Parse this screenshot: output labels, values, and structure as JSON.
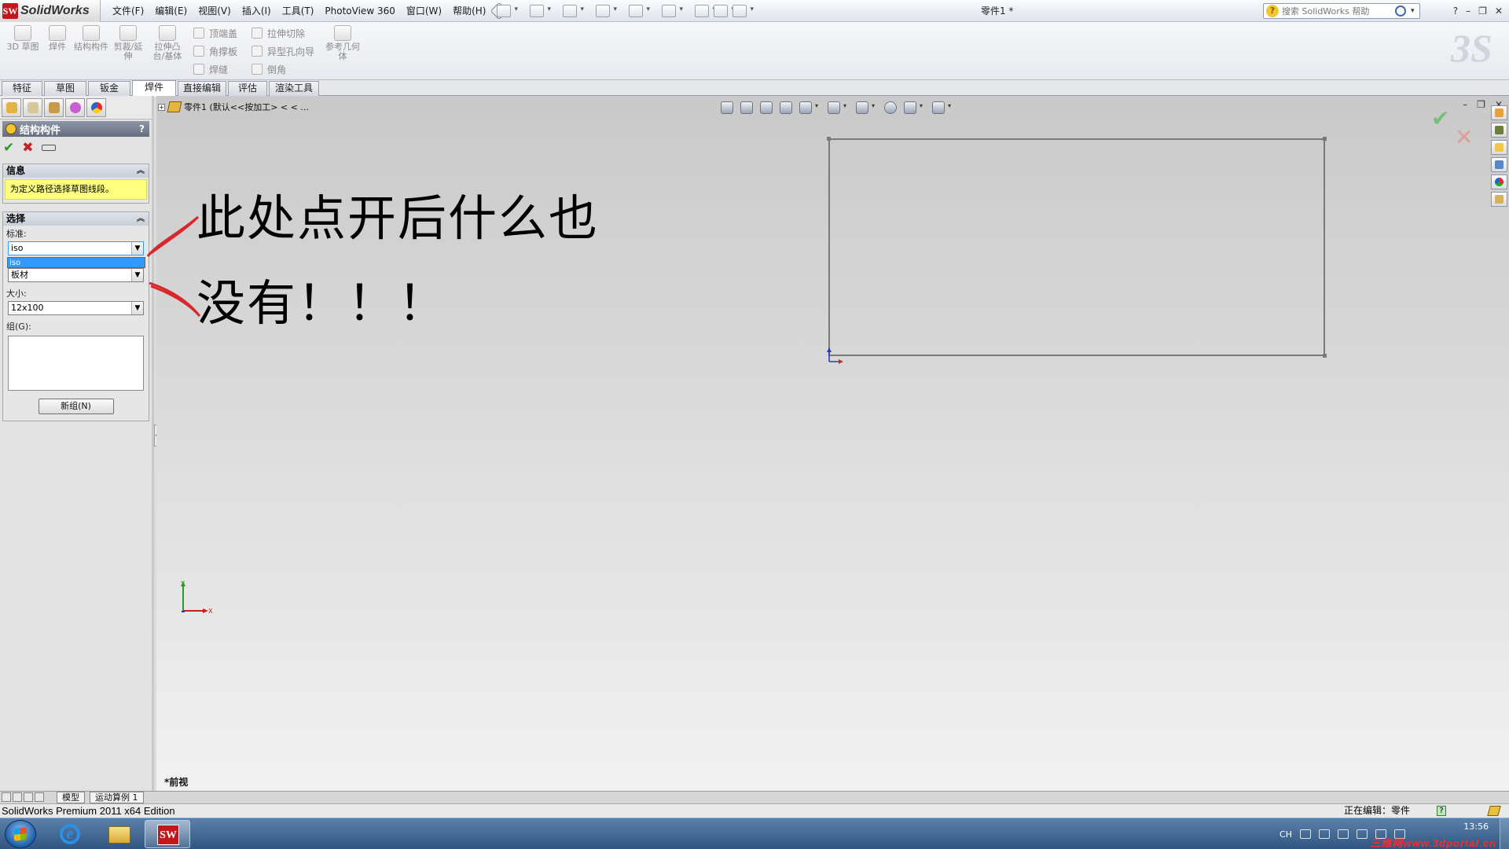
{
  "app": {
    "logo_text": "SolidWorks",
    "logo_mark": "SW",
    "doc_title": "零件1 *",
    "menus": [
      "文件(F)",
      "编辑(E)",
      "视图(V)",
      "插入(I)",
      "工具(T)",
      "PhotoView 360",
      "窗口(W)",
      "帮助(H)"
    ],
    "search_placeholder": "搜索 SolidWorks 帮助",
    "window_controls": [
      "?",
      "–",
      "❐",
      "✕"
    ]
  },
  "commandmanager": {
    "big_buttons": [
      {
        "label": "3D 草图",
        "icon": "3d-sketch-icon"
      },
      {
        "label": "焊件",
        "icon": "weldment-icon"
      },
      {
        "label": "结构构件",
        "icon": "structural-member-icon"
      },
      {
        "label": "剪裁/延伸",
        "icon": "trim-extend-icon"
      },
      {
        "label": "拉伸凸台/基体",
        "icon": "extruded-boss-icon"
      }
    ],
    "small_buttons_col1": [
      "顶端盖",
      "角撑板",
      "焊缝"
    ],
    "small_buttons_col2": [
      "拉伸切除",
      "异型孔向导",
      "倒角"
    ],
    "ref_geometry": "参考几何体"
  },
  "tabs": {
    "items": [
      "特征",
      "草图",
      "钣金",
      "焊件",
      "直接编辑",
      "评估",
      "渲染工具"
    ],
    "active_index": 3
  },
  "property_manager": {
    "title": "结构构件",
    "help": "?",
    "ok": "✔",
    "cancel": "✖",
    "info_group": {
      "title": "信息",
      "message": "为定义路径选择草图线段。"
    },
    "selection_group": {
      "title": "选择",
      "standard_label": "标准:",
      "standard_value": "iso",
      "standard_dropdown_items": [
        "iso"
      ],
      "type_value": "板材",
      "size_label": "大小:",
      "size_value": "12x100",
      "group_label": "组(G):",
      "new_group_button": "新组(N)"
    }
  },
  "viewport": {
    "tree_flyout": "零件1  (默认<<按加工> < < ...",
    "view_label": "*前视",
    "triad": {
      "x": "X",
      "y": "Y"
    }
  },
  "annotation": {
    "line1": "此处点开后什么也",
    "line2": "没有！！！"
  },
  "bottom_tabs": [
    "模型",
    "运动算例 1"
  ],
  "status": {
    "left": "SolidWorks Premium 2011 x64 Edition",
    "right": "正在编辑：零件",
    "help": "?"
  },
  "taskbar": {
    "lang": "CH",
    "time": "13:56",
    "watermark": "三维网www.3dportal.cn"
  },
  "colors": {
    "annotation_arrow": "#d8262a",
    "sketch_line": "#7a7a7a",
    "info_yellow": "#ffff80",
    "accent_blue": "#3399ff"
  }
}
